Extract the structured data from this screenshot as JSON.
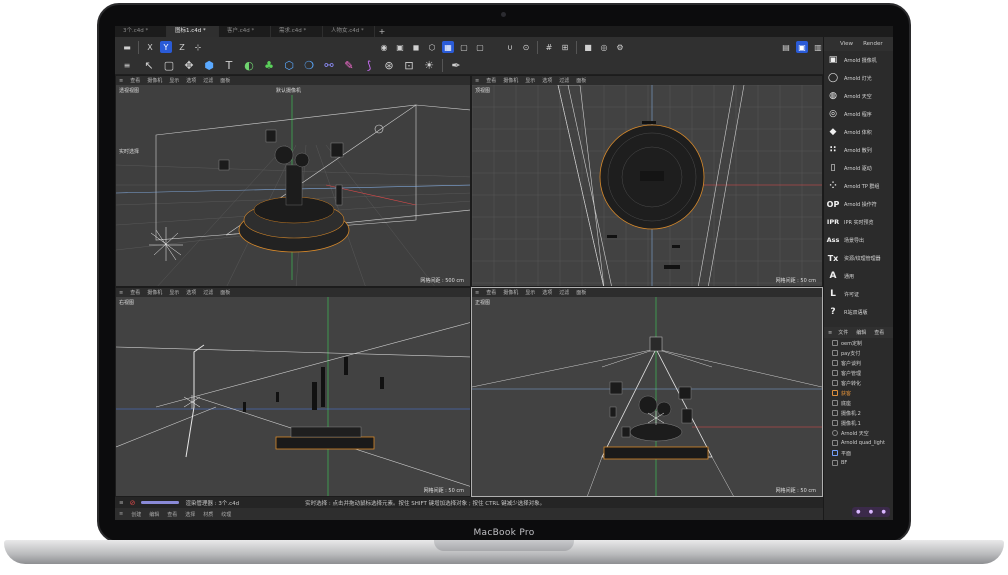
{
  "device": {
    "brand_label": "MacBook Pro"
  },
  "tabs": [
    {
      "label": "3个.c4d *",
      "active": false
    },
    {
      "label": "图标1.c4d *",
      "active": true
    },
    {
      "label": "客户.c4d *",
      "active": false
    },
    {
      "label": "需求.c4d *",
      "active": false
    },
    {
      "label": "人物女.c4d *",
      "active": false
    }
  ],
  "tab_add": "+",
  "toolbar": {
    "axis_x": "X",
    "axis_y": "Y",
    "axis_z": "Z",
    "text_tool": "T"
  },
  "viewports": [
    {
      "menu": [
        "查看",
        "摄像机",
        "显示",
        "选项",
        "过滤",
        "面板"
      ],
      "label": "透视视图",
      "camera_label": "默认摄像机",
      "selection_label": "实时选择",
      "scale": "网格间距 : 500 cm"
    },
    {
      "menu": [
        "查看",
        "摄像机",
        "显示",
        "选项",
        "过滤",
        "面板"
      ],
      "label": "顶视图",
      "scale": "网格间距 : 50 cm"
    },
    {
      "menu": [
        "查看",
        "摄像机",
        "显示",
        "选项",
        "过滤",
        "面板"
      ],
      "label": "右视图",
      "scale": "网格间距 : 50 cm"
    },
    {
      "menu": [
        "查看",
        "摄像机",
        "显示",
        "选项",
        "过滤",
        "面板"
      ],
      "label": "正视图",
      "scale": "网格间距 : 50 cm"
    }
  ],
  "status": {
    "render_manager": "渲染管理器 : 3个.c4d",
    "hint": "实时选择 : 点击并拖动鼠标选择元素。按住 SHIFT 键增加选择对象 ; 按住 CTRL 键减少选择对象。"
  },
  "bottom_menu": [
    "创建",
    "编辑",
    "查看",
    "选择",
    "材质",
    "纹理"
  ],
  "right_panel": {
    "header": [
      "View",
      "Render"
    ],
    "items": [
      {
        "icon": "▣",
        "label": "Arnold 摄像机"
      },
      {
        "icon": "◯",
        "label": "Arnold 灯光"
      },
      {
        "icon": "◍",
        "label": "Arnold 天空"
      },
      {
        "icon": "◎",
        "label": "Arnold 程序"
      },
      {
        "icon": "◆",
        "label": "Arnold 体积"
      },
      {
        "icon": "∷",
        "label": "Arnold 散列"
      },
      {
        "icon": "▯",
        "label": "Arnold 驱动"
      },
      {
        "icon": "⁘",
        "label": "Arnold TP 群组"
      },
      {
        "icon": "OP",
        "label": "Arnold 操作符"
      },
      {
        "icon": "IPR",
        "label": "IPR 实时预览"
      },
      {
        "icon": "Ass",
        "label": "场景导出"
      },
      {
        "icon": "Tx",
        "label": "资源/纹理管理器"
      },
      {
        "icon": "A",
        "label": "通用"
      },
      {
        "icon": "L",
        "label": "许可证"
      },
      {
        "icon": "?",
        "label": "R站双语版"
      }
    ],
    "object_header": [
      "文件",
      "编辑",
      "查看"
    ],
    "objects": [
      {
        "label": "oem定制",
        "highlight": false
      },
      {
        "label": "pay支付",
        "highlight": false
      },
      {
        "label": "客户谈判",
        "highlight": false
      },
      {
        "label": "客户管理",
        "highlight": false
      },
      {
        "label": "客户转化",
        "highlight": false
      },
      {
        "label": "获客",
        "highlight": true
      },
      {
        "label": "底座",
        "highlight": false
      },
      {
        "label": "摄像机.2",
        "highlight": false
      },
      {
        "label": "摄像机.1",
        "highlight": false
      },
      {
        "label": "Arnold 天空",
        "highlight": false
      },
      {
        "label": "Arnold quad_light",
        "highlight": false
      },
      {
        "label": "平面",
        "highlight": false
      },
      {
        "label": "BF",
        "highlight": false
      }
    ]
  },
  "colors": {
    "accent": "#2a5bd7",
    "highlight_text": "#e0913a",
    "axis_y": "#3cd25a",
    "axis_x": "#e04a4a",
    "axis_z": "#4a78e6"
  }
}
